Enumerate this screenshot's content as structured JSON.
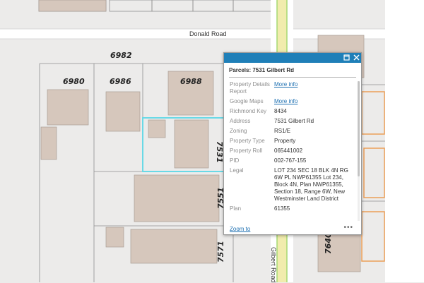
{
  "map": {
    "roads": [
      "Donald Road",
      "Gilbert Road"
    ],
    "parcel_numbers": [
      "6982",
      "6980",
      "6986",
      "6988",
      "7531",
      "7551",
      "7571",
      "7640"
    ],
    "colors": {
      "background": "#ecebea",
      "building": "#d6c7bc",
      "parcel_line": "#8f8f8f",
      "road": "#ffffff",
      "gilbert_road_fill": "#f1ecad",
      "gilbert_road_edge": "#a5d873",
      "selected_parcel": "#69d9e6",
      "orange_building": "#eb9f58"
    }
  },
  "popup": {
    "title": "Parcels: 7531 Gilbert Rd",
    "header_color": "#1f7fb8",
    "maximize_icon": "maximize-icon",
    "close_icon": "close-icon",
    "fields": [
      {
        "key": "Property Details Report",
        "value": "More info",
        "link": true
      },
      {
        "key": "Google Maps",
        "value": "More info",
        "link": true
      },
      {
        "key": "Richmond Key",
        "value": "8434",
        "link": false
      },
      {
        "key": "Address",
        "value": "7531 Gilbert Rd",
        "link": false
      },
      {
        "key": "Zoning",
        "value": "RS1/E",
        "link": false
      },
      {
        "key": "Property Type",
        "value": "Property",
        "link": false
      },
      {
        "key": "Property Roll",
        "value": "065441002",
        "link": false
      },
      {
        "key": "PID",
        "value": "002-767-155",
        "link": false
      },
      {
        "key": "Legal",
        "value": "LOT 234 SEC 18 BLK 4N RG 6W PL NWP61355 Lot 234, Block 4N, Plan NWP61355, Section 18, Range 6W, New Westminster Land District",
        "link": false
      },
      {
        "key": "Plan",
        "value": "61355",
        "link": false
      }
    ],
    "zoom_to": "Zoom to",
    "more_dots": "•••"
  }
}
